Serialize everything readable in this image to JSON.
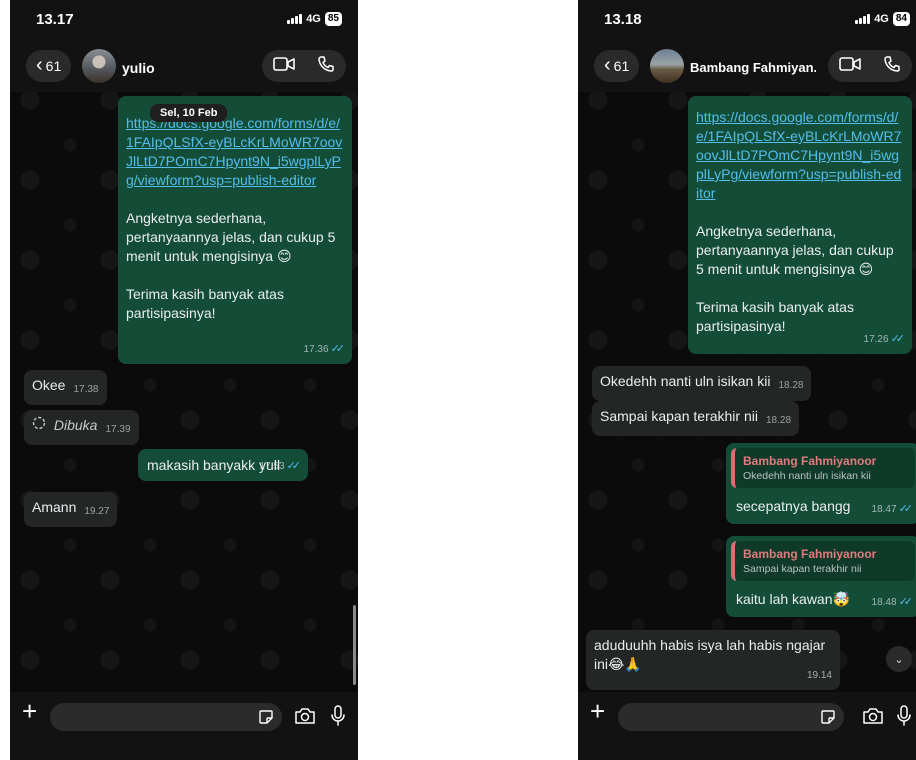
{
  "left": {
    "status": {
      "time": "13.17",
      "network": "4G",
      "battery": "85"
    },
    "header": {
      "back_count": "61",
      "contact_name": "yulio"
    },
    "date_label": "Sel, 10 Feb",
    "messages": [
      {
        "link": "https://docs.google.com/forms/d/e/1FAIpQLSfX-eyBLcKrLMoWR7oovJlLtD7POmC7Hpynt9N_i5wgplLyPg/viewform?usp=publish-editor",
        "body": "Angketnya sederhana, pertanyaannya jelas, dan cukup 5 menit untuk mengisinya 😊\n\nTerima kasih banyak atas partisipasinya!",
        "time": "17.36"
      },
      {
        "text": "Okee",
        "time": "17.38"
      },
      {
        "text": "Dibuka",
        "time": "17.39"
      },
      {
        "text": "makasih banyakk yull",
        "time": "17.53"
      },
      {
        "text": "Amann",
        "time": "19.27"
      }
    ]
  },
  "right": {
    "status": {
      "time": "13.18",
      "network": "4G",
      "battery": "84"
    },
    "header": {
      "back_count": "61",
      "contact_name": "Bambang Fahmiyan..."
    },
    "messages": [
      {
        "link": "https://docs.google.com/forms/d/e/1FAIpQLSfX-eyBLcKrLMoWR7oovJlLtD7POmC7Hpynt9N_i5wgplLyPg/viewform?usp=publish-editor",
        "body": "Angketnya sederhana, pertanyaannya jelas, dan cukup 5 menit untuk mengisinya 😊\n\nTerima kasih banyak atas partisipasinya!",
        "time": "17.26"
      },
      {
        "text": "Okedehh nanti uln isikan kii",
        "time": "18.28"
      },
      {
        "text": "Sampai kapan terakhir nii",
        "time": "18.28"
      },
      {
        "quote_name": "Bambang Fahmiyanoor",
        "quote_text": "Okedehh nanti uln isikan kii",
        "text": "secepatnya bangg",
        "time": "18.47"
      },
      {
        "quote_name": "Bambang Fahmiyanoor",
        "quote_text": "Sampai kapan terakhir nii",
        "text": "kaitu lah kawan🤯",
        "time": "18.48"
      },
      {
        "text": "aduduuhh habis isya lah habis ngajar ini😂🙏",
        "time": "19.14"
      }
    ]
  },
  "icons": {
    "back": "chevron-left-icon",
    "video": "video-call-icon",
    "voice": "phone-call-icon",
    "plus": "plus-icon",
    "sticker": "sticker-icon",
    "camera": "camera-icon",
    "mic": "microphone-icon",
    "read": "double-check-icon",
    "scroll": "chevron-down-icon"
  },
  "colors": {
    "outgoing": "#144d37",
    "incoming": "#242626",
    "link": "#53bdeb",
    "read_ticks": "#53bdeb",
    "quote_name": "#e27a7e"
  }
}
